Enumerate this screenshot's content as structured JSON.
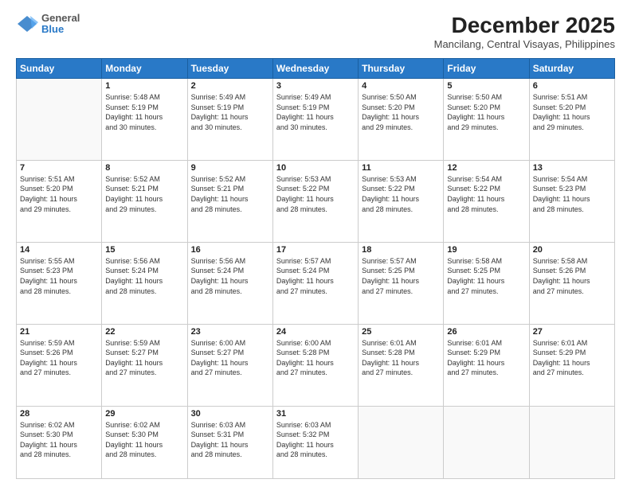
{
  "header": {
    "logo": {
      "general": "General",
      "blue": "Blue"
    },
    "title": "December 2025",
    "location": "Mancilang, Central Visayas, Philippines"
  },
  "days_header": [
    "Sunday",
    "Monday",
    "Tuesday",
    "Wednesday",
    "Thursday",
    "Friday",
    "Saturday"
  ],
  "weeks": [
    [
      {
        "day": "",
        "info": ""
      },
      {
        "day": "1",
        "info": "Sunrise: 5:48 AM\nSunset: 5:19 PM\nDaylight: 11 hours\nand 30 minutes."
      },
      {
        "day": "2",
        "info": "Sunrise: 5:49 AM\nSunset: 5:19 PM\nDaylight: 11 hours\nand 30 minutes."
      },
      {
        "day": "3",
        "info": "Sunrise: 5:49 AM\nSunset: 5:19 PM\nDaylight: 11 hours\nand 30 minutes."
      },
      {
        "day": "4",
        "info": "Sunrise: 5:50 AM\nSunset: 5:20 PM\nDaylight: 11 hours\nand 29 minutes."
      },
      {
        "day": "5",
        "info": "Sunrise: 5:50 AM\nSunset: 5:20 PM\nDaylight: 11 hours\nand 29 minutes."
      },
      {
        "day": "6",
        "info": "Sunrise: 5:51 AM\nSunset: 5:20 PM\nDaylight: 11 hours\nand 29 minutes."
      }
    ],
    [
      {
        "day": "7",
        "info": "Sunrise: 5:51 AM\nSunset: 5:20 PM\nDaylight: 11 hours\nand 29 minutes."
      },
      {
        "day": "8",
        "info": "Sunrise: 5:52 AM\nSunset: 5:21 PM\nDaylight: 11 hours\nand 29 minutes."
      },
      {
        "day": "9",
        "info": "Sunrise: 5:52 AM\nSunset: 5:21 PM\nDaylight: 11 hours\nand 28 minutes."
      },
      {
        "day": "10",
        "info": "Sunrise: 5:53 AM\nSunset: 5:22 PM\nDaylight: 11 hours\nand 28 minutes."
      },
      {
        "day": "11",
        "info": "Sunrise: 5:53 AM\nSunset: 5:22 PM\nDaylight: 11 hours\nand 28 minutes."
      },
      {
        "day": "12",
        "info": "Sunrise: 5:54 AM\nSunset: 5:22 PM\nDaylight: 11 hours\nand 28 minutes."
      },
      {
        "day": "13",
        "info": "Sunrise: 5:54 AM\nSunset: 5:23 PM\nDaylight: 11 hours\nand 28 minutes."
      }
    ],
    [
      {
        "day": "14",
        "info": "Sunrise: 5:55 AM\nSunset: 5:23 PM\nDaylight: 11 hours\nand 28 minutes."
      },
      {
        "day": "15",
        "info": "Sunrise: 5:56 AM\nSunset: 5:24 PM\nDaylight: 11 hours\nand 28 minutes."
      },
      {
        "day": "16",
        "info": "Sunrise: 5:56 AM\nSunset: 5:24 PM\nDaylight: 11 hours\nand 28 minutes."
      },
      {
        "day": "17",
        "info": "Sunrise: 5:57 AM\nSunset: 5:24 PM\nDaylight: 11 hours\nand 27 minutes."
      },
      {
        "day": "18",
        "info": "Sunrise: 5:57 AM\nSunset: 5:25 PM\nDaylight: 11 hours\nand 27 minutes."
      },
      {
        "day": "19",
        "info": "Sunrise: 5:58 AM\nSunset: 5:25 PM\nDaylight: 11 hours\nand 27 minutes."
      },
      {
        "day": "20",
        "info": "Sunrise: 5:58 AM\nSunset: 5:26 PM\nDaylight: 11 hours\nand 27 minutes."
      }
    ],
    [
      {
        "day": "21",
        "info": "Sunrise: 5:59 AM\nSunset: 5:26 PM\nDaylight: 11 hours\nand 27 minutes."
      },
      {
        "day": "22",
        "info": "Sunrise: 5:59 AM\nSunset: 5:27 PM\nDaylight: 11 hours\nand 27 minutes."
      },
      {
        "day": "23",
        "info": "Sunrise: 6:00 AM\nSunset: 5:27 PM\nDaylight: 11 hours\nand 27 minutes."
      },
      {
        "day": "24",
        "info": "Sunrise: 6:00 AM\nSunset: 5:28 PM\nDaylight: 11 hours\nand 27 minutes."
      },
      {
        "day": "25",
        "info": "Sunrise: 6:01 AM\nSunset: 5:28 PM\nDaylight: 11 hours\nand 27 minutes."
      },
      {
        "day": "26",
        "info": "Sunrise: 6:01 AM\nSunset: 5:29 PM\nDaylight: 11 hours\nand 27 minutes."
      },
      {
        "day": "27",
        "info": "Sunrise: 6:01 AM\nSunset: 5:29 PM\nDaylight: 11 hours\nand 27 minutes."
      }
    ],
    [
      {
        "day": "28",
        "info": "Sunrise: 6:02 AM\nSunset: 5:30 PM\nDaylight: 11 hours\nand 28 minutes."
      },
      {
        "day": "29",
        "info": "Sunrise: 6:02 AM\nSunset: 5:30 PM\nDaylight: 11 hours\nand 28 minutes."
      },
      {
        "day": "30",
        "info": "Sunrise: 6:03 AM\nSunset: 5:31 PM\nDaylight: 11 hours\nand 28 minutes."
      },
      {
        "day": "31",
        "info": "Sunrise: 6:03 AM\nSunset: 5:32 PM\nDaylight: 11 hours\nand 28 minutes."
      },
      {
        "day": "",
        "info": ""
      },
      {
        "day": "",
        "info": ""
      },
      {
        "day": "",
        "info": ""
      }
    ]
  ]
}
